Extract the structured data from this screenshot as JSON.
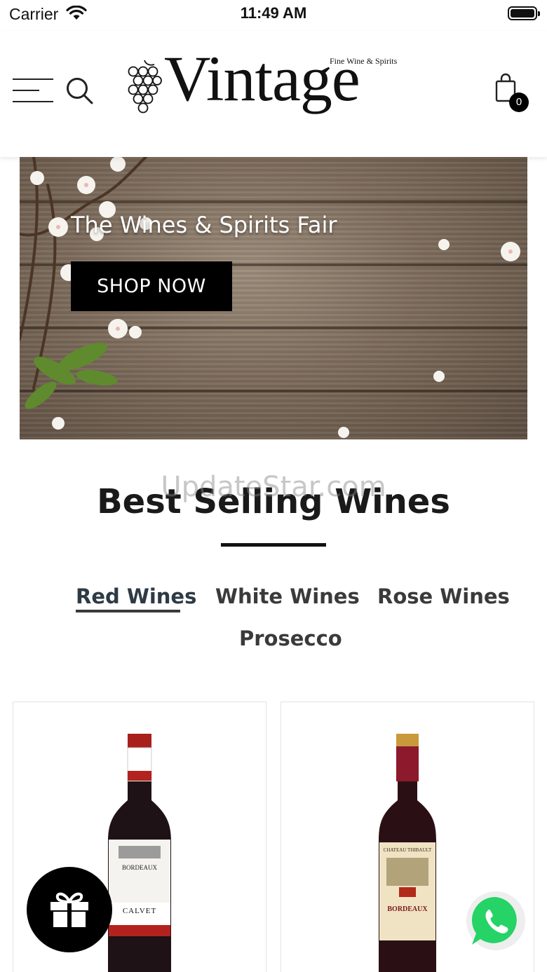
{
  "status_bar": {
    "carrier": "Carrier",
    "time": "11:49 AM"
  },
  "header": {
    "brand": "Vintage",
    "tagline": "Fine Wine & Spirits",
    "cart_count": "0",
    "icons": [
      "menu-icon",
      "search-icon",
      "grapes-icon",
      "shopping-bag-icon"
    ]
  },
  "hero": {
    "title": "The Wines & Spirits Fair",
    "button_label": "SHOP NOW"
  },
  "best_selling": {
    "watermark": "UpdateStar.com",
    "title": "Best Selling Wines",
    "tabs": [
      {
        "label": "Red Wines",
        "active": true
      },
      {
        "label": "White Wines",
        "active": false
      },
      {
        "label": "Rose Wines",
        "active": false
      },
      {
        "label": "Prosecco",
        "active": false
      }
    ]
  },
  "products": [
    {
      "label_brand": "CALVET",
      "label_region": "BORDEAUX"
    },
    {
      "label_brand": "CHATEAU THIBAULT",
      "label_region": "BORDEAUX"
    }
  ],
  "floating": {
    "gift_icon": "gift-icon",
    "whatsapp_icon": "whatsapp-icon"
  },
  "colors": {
    "accent": "#000000",
    "whatsapp": "#25d366",
    "text": "#1a1a1a"
  }
}
